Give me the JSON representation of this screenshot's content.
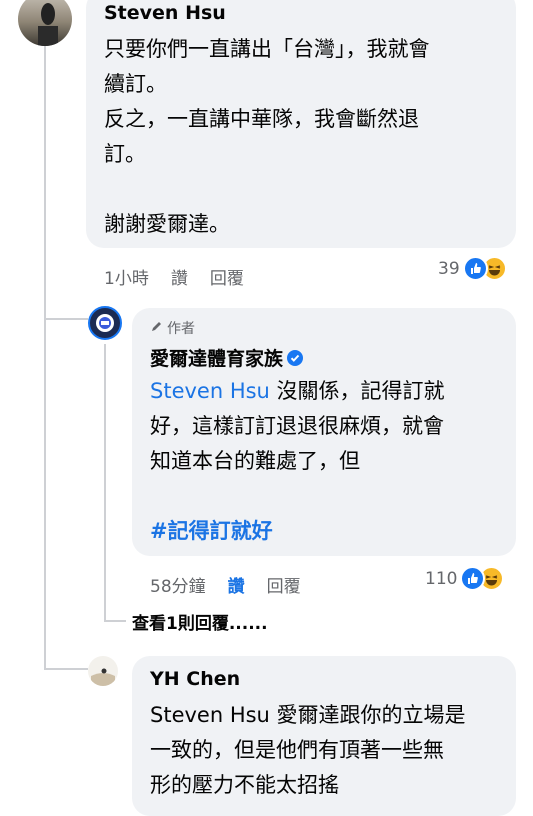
{
  "comment1": {
    "author": "Steven Hsu",
    "lines": [
      "只要你們一直講出「台灣」，我就會",
      "續訂。",
      "反之，一直講中華隊，我會斷然退",
      "訂。",
      "",
      "謝謝愛爾達。"
    ],
    "time": "1小時",
    "like_label": "讚",
    "reply_label": "回覆",
    "reaction_count": "39",
    "reaction_icons": [
      "like-icon",
      "haha-icon"
    ]
  },
  "reply1": {
    "author_tag": "作者",
    "author": "愛爾達體育家族",
    "mention": "Steven Hsu",
    "line1_rest": " 沒關係，記得訂就",
    "lines": [
      "好，這樣訂訂退退很麻煩，就會",
      "知道本台的難處了，但"
    ],
    "hashtag": "#記得訂就好",
    "time": "58分鐘",
    "like_label": "讚",
    "reply_label": "回覆",
    "reaction_count": "110",
    "reaction_icons": [
      "like-icon",
      "haha-icon"
    ],
    "accent_color": "#1b74e4"
  },
  "view_more": "查看1則回覆......",
  "comment2": {
    "author": "YH Chen",
    "lines": [
      "Steven Hsu 愛爾達跟你的立場是",
      "一致的，但是他們有頂著一些無",
      "形的壓力不能太招搖"
    ]
  }
}
